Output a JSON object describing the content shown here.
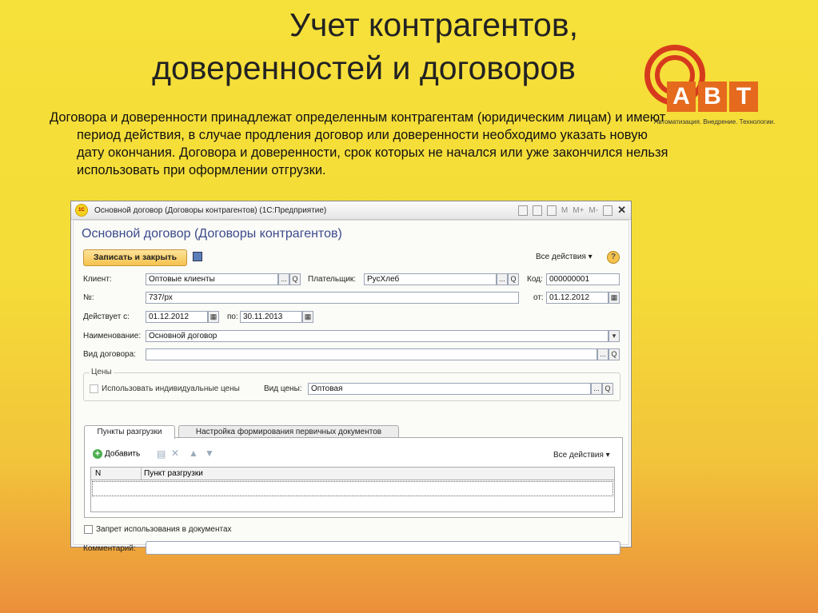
{
  "slide": {
    "title_line1": "Учет контрагентов,",
    "title_line2": "доверенностей и договоров",
    "description": "Договора и доверенности принадлежат определенным контрагентам (юридическим лицам) и имеют период действия, в случае продления договор или доверенности необходимо указать новую дату окончания. Договора и доверенности, срок которых не начался или уже закончился нельзя использовать при оформлении отгрузки."
  },
  "logo": {
    "letters": [
      "А",
      "В",
      "Т"
    ],
    "tagline": "Автоматизация. Внедрение. Технологии."
  },
  "window": {
    "app_icon": "1С",
    "title": "Основной договор (Договоры контрагентов)  (1С:Предприятие)",
    "tb_m": "M",
    "tb_mplus": "M+",
    "tb_mminus": "M-",
    "form_title": "Основной договор (Договоры контрагентов)",
    "save_close": "Записать и закрыть",
    "all_actions": "Все действия ▾",
    "help": "?"
  },
  "fields": {
    "client_label": "Клиент:",
    "client_value": "Оптовые клиенты",
    "payer_label": "Плательщик:",
    "payer_value": "РусХлеб",
    "code_label": "Код:",
    "code_value": "000000001",
    "number_label": "№:",
    "number_value": "737/рх",
    "from_label": "от:",
    "from_value": "01.12.2012",
    "valid_from_label": "Действует с:",
    "valid_from_value": "01.12.2012",
    "to_label": "по:",
    "to_value": "30.11.2013",
    "name_label": "Наименование:",
    "name_value": "Основной договор",
    "kind_label": "Вид договора:",
    "kind_value": "",
    "prices_group": "Цены",
    "individual_prices_label": "Использовать индивидуальные цены",
    "price_type_label": "Вид цены:",
    "price_type_value": "Оптовая",
    "ban_label": "Запрет использования в документах",
    "comment_label": "Комментарий:",
    "comment_value": "",
    "dots": "...",
    "search": "Q",
    "dropdown": "▾"
  },
  "tabs": [
    {
      "label": "Пункты разгрузки"
    },
    {
      "label": "Настройка формирования первичных документов"
    }
  ],
  "table": {
    "add_label": "Добавить",
    "all_actions": "Все действия ▾",
    "col_n": "N",
    "col_point": "Пункт разгрузки"
  },
  "colors": {
    "accent": "#3c4a8c",
    "logo_red": "#d63a1d",
    "logo_orange": "#e56a1d",
    "button": "#f5c24d"
  }
}
